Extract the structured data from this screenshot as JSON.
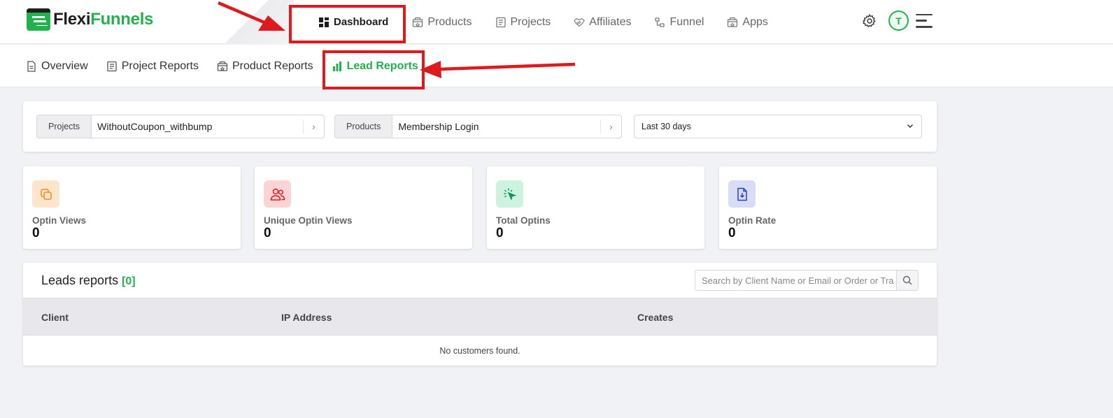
{
  "brand": {
    "part1": "Flexi",
    "part2": "Funnels"
  },
  "topnav": [
    {
      "label": "Dashboard",
      "icon": "grid-icon",
      "active": true
    },
    {
      "label": "Products",
      "icon": "box-icon"
    },
    {
      "label": "Projects",
      "icon": "document-icon"
    },
    {
      "label": "Affiliates",
      "icon": "handshake-icon"
    },
    {
      "label": "Funnel",
      "icon": "funnel-icon"
    },
    {
      "label": "Apps",
      "icon": "apps-icon"
    }
  ],
  "user": {
    "initial": "T"
  },
  "subnav": [
    {
      "label": "Overview",
      "icon": "file-icon"
    },
    {
      "label": "Project Reports",
      "icon": "report-icon"
    },
    {
      "label": "Product Reports",
      "icon": "box-icon"
    },
    {
      "label": "Lead Reports",
      "icon": "bar-chart-icon",
      "active": true
    }
  ],
  "filters": {
    "projects_label": "Projects",
    "projects_value": "WithoutCoupon_withbump",
    "products_label": "Products",
    "products_value": "Membership Login",
    "date_range": "Last 30 days"
  },
  "stats": [
    {
      "label": "Optin Views",
      "value": "0",
      "icon": "copy-icon",
      "color": "#f08a24",
      "bg": "#fde5cc"
    },
    {
      "label": "Unique Optin Views",
      "value": "0",
      "icon": "users-icon",
      "color": "#e0191c",
      "bg": "#fbd5d5"
    },
    {
      "label": "Total Optins",
      "value": "0",
      "icon": "cursor-click-icon",
      "color": "#14955a",
      "bg": "#cdf3e0"
    },
    {
      "label": "Optin Rate",
      "value": "0",
      "icon": "file-download-icon",
      "color": "#2b3ec7",
      "bg": "#d9dcf6"
    }
  ],
  "leads": {
    "title": "Leads reports",
    "count": "[0]",
    "search_placeholder": "Search by Client Name or Email or Order or Tra",
    "columns": [
      "Client",
      "IP Address",
      "Creates"
    ],
    "empty_text": "No customers found."
  },
  "colors": {
    "accent": "#22b14c",
    "highlight": "#e0191c"
  }
}
